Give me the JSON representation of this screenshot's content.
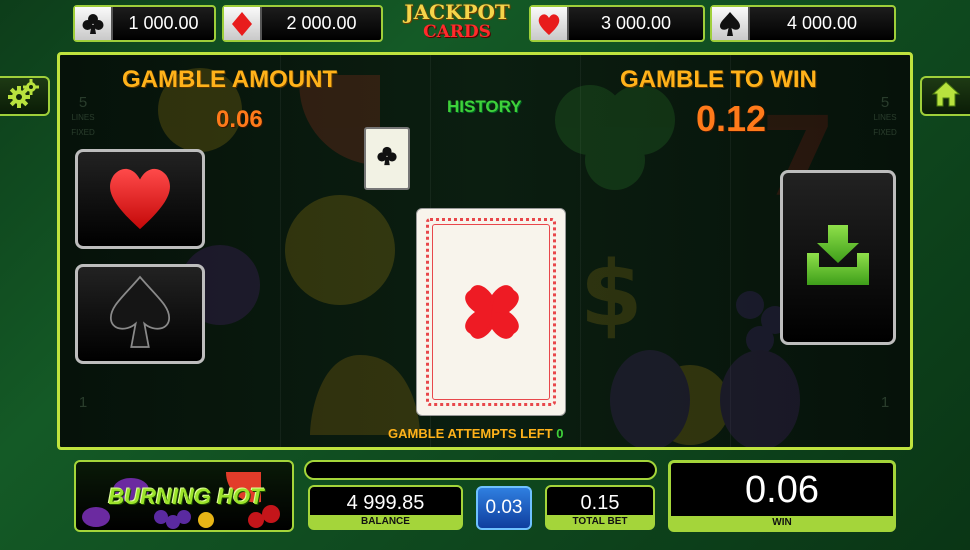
{
  "jackpots": [
    {
      "suit": "clubs",
      "icon": "club-icon",
      "value": "1 000.00"
    },
    {
      "suit": "diamonds",
      "icon": "diamond-icon",
      "value": "2 000.00"
    },
    {
      "suit": "hearts",
      "icon": "heart-icon",
      "value": "3 000.00"
    },
    {
      "suit": "spades",
      "icon": "spade-icon",
      "value": "4 000.00"
    }
  ],
  "jackpot_logo": {
    "line1": "JACKPOT",
    "line2": "CARDS"
  },
  "gamble": {
    "amount_label": "GAMBLE AMOUNT",
    "amount_value": "0.06",
    "to_win_label": "GAMBLE TO WIN",
    "to_win_value": "0.12",
    "history_label": "HISTORY",
    "attempts_label": "GAMBLE ATTEMPTS LEFT",
    "attempts_value": "0"
  },
  "side_lines": {
    "count": "5",
    "word": "LINES",
    "fixed": "FIXED",
    "bottom": "1"
  },
  "game_logo": {
    "text": "BURNING HOT"
  },
  "bottom": {
    "balance_value": "4 999.85",
    "balance_label": "BALANCE",
    "bet_value": "0.03",
    "total_bet_value": "0.15",
    "total_bet_label": "TOTAL BET",
    "win_value": "0.06",
    "win_label": "WIN"
  },
  "colors": {
    "accent_green": "#a4d53a",
    "title_orange": "#ffb21a",
    "value_orange": "#ff7a1a",
    "history_green": "#3fd13a",
    "card_red": "#ee1b24"
  }
}
